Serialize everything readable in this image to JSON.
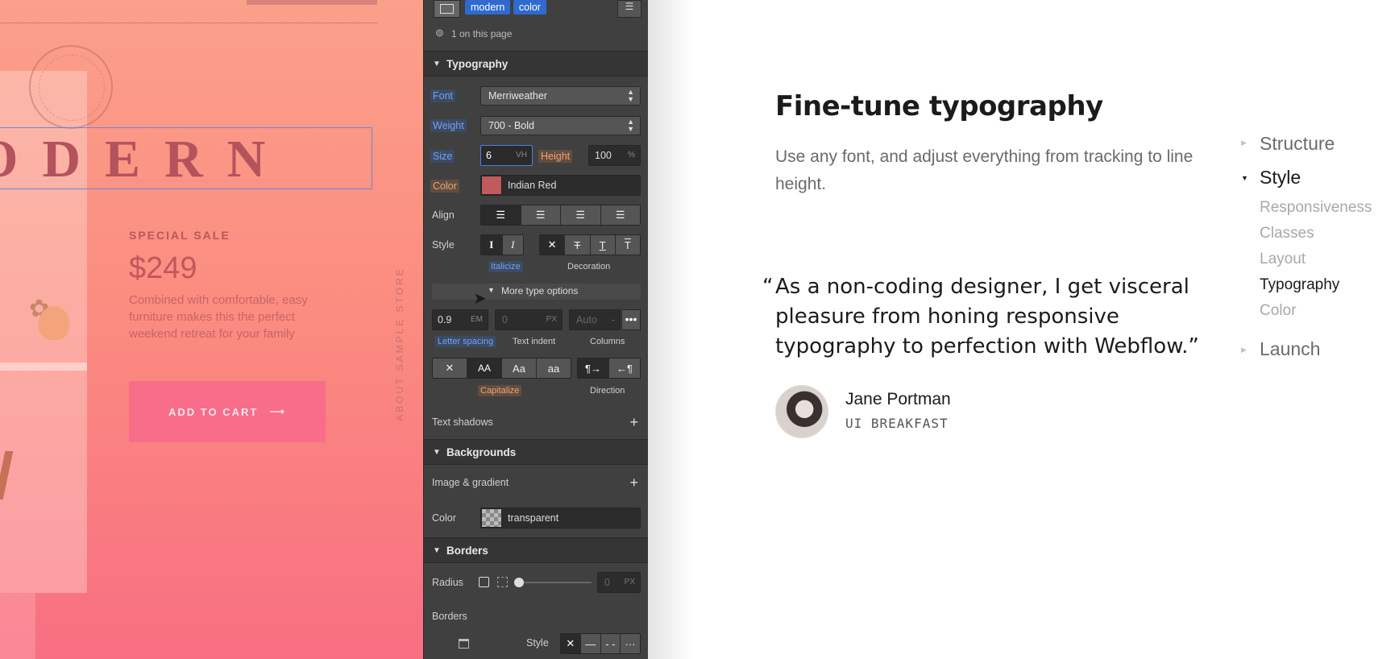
{
  "canvas": {
    "hero_word": "ODERN",
    "sale_label": "SPECIAL SALE",
    "price": "$249",
    "description": "Combined with comfortable, easy furniture makes this the perfect weekend retreat for your family",
    "cart_button": "ADD TO CART",
    "cart_arrow": "⟶",
    "vertical_text": "ABOUT SAMPLE STORE",
    "colors": {
      "background_top": "#fba08a",
      "background_bottom": "#f86f82",
      "cart_button": "#f86d8a",
      "selection_outline": "#6f86d6"
    }
  },
  "panel": {
    "tags": [
      "modern",
      "color"
    ],
    "on_page": "1 on this page",
    "typography": {
      "title": "Typography",
      "font_label": "Font",
      "font_value": "Merriweather",
      "weight_label": "Weight",
      "weight_value": "700 - Bold",
      "size_label": "Size",
      "size_value": "6",
      "size_unit": "VH",
      "height_label": "Height",
      "height_value": "100",
      "height_unit": "%",
      "color_label": "Color",
      "color_value": "Indian Red",
      "align_label": "Align",
      "style_label": "Style",
      "italicize_label": "Italicize",
      "decoration_label": "Decoration",
      "more_options": "More type options",
      "letter_spacing_value": "0.9",
      "letter_spacing_unit": "EM",
      "text_indent_value": "0",
      "text_indent_unit": "PX",
      "columns_value": "Auto",
      "columns_dash": "-",
      "letter_spacing_label": "Letter spacing",
      "text_indent_label": "Text indent",
      "columns_label": "Columns",
      "case_options": [
        "✕",
        "AA",
        "Aa",
        "aa"
      ],
      "capitalize_label": "Capitalize",
      "direction_label": "Direction",
      "text_shadows_label": "Text shadows",
      "style_buttons": [
        "I",
        "I",
        "✕",
        "T",
        "T",
        "T"
      ]
    },
    "backgrounds": {
      "title": "Backgrounds",
      "image_gradient_label": "Image & gradient",
      "color_label": "Color",
      "color_value": "transparent"
    },
    "borders": {
      "title": "Borders",
      "radius_label": "Radius",
      "radius_value": "0",
      "radius_unit": "PX",
      "borders_label": "Borders",
      "style_label": "Style"
    },
    "colors": {
      "panel_bg": "#404040",
      "accent_blue": "#2f6bcf",
      "accent_orange": "#f2a46c",
      "indian_red": "#c05a5c"
    }
  },
  "content": {
    "heading": "Fine-tune typography",
    "lead": "Use any font, and adjust everything from tracking to line height.",
    "quote_open": "“",
    "quote": "As a non-coding designer, I get visceral pleasure from honing responsive typography to perfection with Webflow.”",
    "author_name": "Jane Portman",
    "author_company": "UI BREAKFAST"
  },
  "nav": {
    "structure": "Structure",
    "style": "Style",
    "responsiveness": "Responsiveness",
    "classes": "Classes",
    "layout": "Layout",
    "typography": "Typography",
    "color": "Color",
    "launch": "Launch"
  }
}
